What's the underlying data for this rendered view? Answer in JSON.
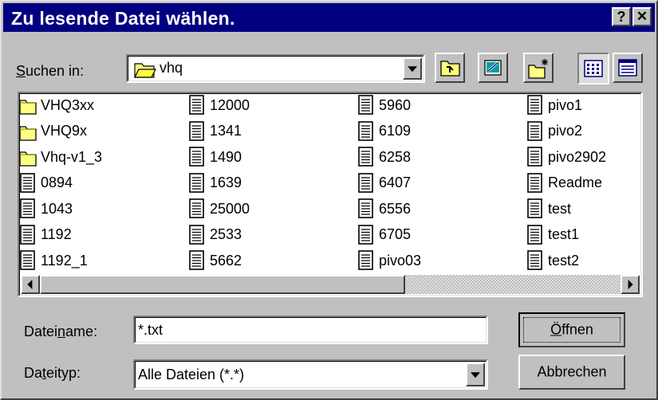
{
  "window": {
    "title": "Zu lesende Datei wählen.",
    "help_button": "?",
    "close_button": "✕"
  },
  "lookin": {
    "label_pre": "",
    "label_u": "S",
    "label_post": "uchen in:",
    "value": "vhq"
  },
  "files": [
    {
      "name": "VHQ3xx",
      "type": "folder"
    },
    {
      "name": "VHQ9x",
      "type": "folder"
    },
    {
      "name": "Vhq-v1_3",
      "type": "folder"
    },
    {
      "name": "0894",
      "type": "file"
    },
    {
      "name": "1043",
      "type": "file"
    },
    {
      "name": "1192",
      "type": "file"
    },
    {
      "name": "1192_1",
      "type": "file"
    },
    {
      "name": "12000",
      "type": "file"
    },
    {
      "name": "1341",
      "type": "file"
    },
    {
      "name": "1490",
      "type": "file"
    },
    {
      "name": "1639",
      "type": "file"
    },
    {
      "name": "25000",
      "type": "file"
    },
    {
      "name": "2533",
      "type": "file"
    },
    {
      "name": "5662",
      "type": "file"
    },
    {
      "name": "5960",
      "type": "file"
    },
    {
      "name": "6109",
      "type": "file"
    },
    {
      "name": "6258",
      "type": "file"
    },
    {
      "name": "6407",
      "type": "file"
    },
    {
      "name": "6556",
      "type": "file"
    },
    {
      "name": "6705",
      "type": "file"
    },
    {
      "name": "pivo03",
      "type": "file"
    },
    {
      "name": "pivo1",
      "type": "file"
    },
    {
      "name": "pivo2",
      "type": "file"
    },
    {
      "name": "pivo2902",
      "type": "file"
    },
    {
      "name": "Readme",
      "type": "file"
    },
    {
      "name": "test",
      "type": "file"
    },
    {
      "name": "test1",
      "type": "file"
    },
    {
      "name": "test2",
      "type": "file"
    }
  ],
  "filename": {
    "label_pre": "Datei",
    "label_u": "n",
    "label_post": "ame:",
    "value": "*.txt"
  },
  "filetype": {
    "label_pre": "Da",
    "label_u": "t",
    "label_post": "eityp:",
    "value": "Alle Dateien (*.*)"
  },
  "buttons": {
    "open_u": "Ö",
    "open_rest": "ffnen",
    "cancel": "Abbrechen"
  },
  "colors": {
    "titlebar": "#000080",
    "face": "#c0c0c0",
    "folder": "#ffff80"
  },
  "icons": [
    "up-folder-icon",
    "desktop-icon",
    "new-folder-icon",
    "list-view-icon",
    "details-view-icon",
    "folder-icon",
    "text-file-icon"
  ]
}
